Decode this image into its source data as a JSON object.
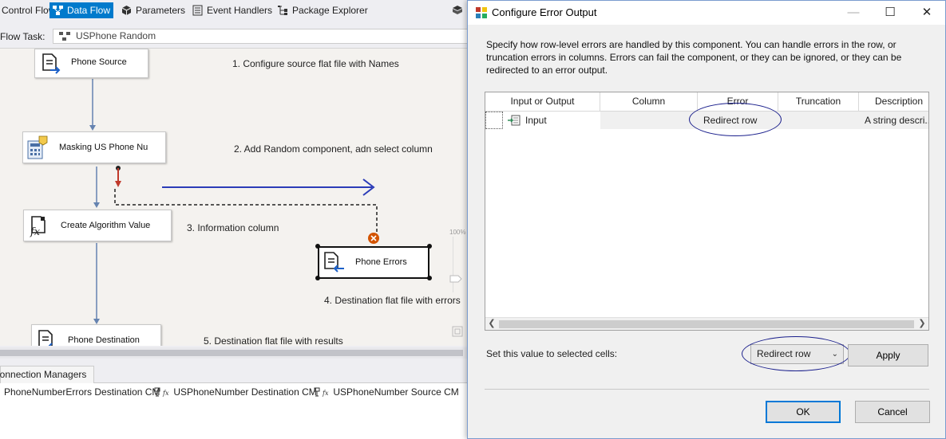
{
  "designer": {
    "tabs": [
      {
        "label": "Control Flow",
        "icon": "control-flow-icon"
      },
      {
        "label": "Data Flow",
        "icon": "data-flow-icon",
        "active": true
      },
      {
        "label": "Parameters",
        "icon": "parameters-icon"
      },
      {
        "label": "Event Handlers",
        "icon": "event-handlers-icon"
      },
      {
        "label": "Package Explorer",
        "icon": "package-explorer-icon"
      }
    ],
    "task_label": "Flow Task:",
    "task_value": "USPhone Random",
    "components": {
      "phone_source": "Phone Source",
      "masking": "Masking US Phone Nu",
      "create_algorithm": "Create Algorithm Value",
      "phone_errors": "Phone Errors",
      "phone_destination": "Phone Destination"
    },
    "notes": {
      "n1": "1. Configure source flat file with Names",
      "n2": "2. Add Random component, adn select column",
      "n3": "3. Information column",
      "n4": "4. Destination flat file with errors",
      "n5": "5. Destination flat file with results"
    },
    "zoom": "100%",
    "connection_managers_tab": "Connection Managers",
    "connection_managers": [
      "PhoneNumberErrors Destination CM",
      "USPhoneNumber Destination CM",
      "USPhoneNumber Source CM"
    ]
  },
  "dialog": {
    "title": "Configure Error Output",
    "description": "Specify how row-level errors are handled by this component. You can handle errors in the row, or truncation errors in columns. Errors can fail the component, or they can be ignored, or they can be redirected to an error output.",
    "columns": {
      "input_or_output": "Input or Output",
      "column": "Column",
      "error": "Error",
      "truncation": "Truncation",
      "description": "Description"
    },
    "rows": [
      {
        "input_or_output": "Input",
        "column": "",
        "error": "Redirect row",
        "truncation": "",
        "description": "A string descri..."
      }
    ],
    "set_value_label": "Set this value to selected cells:",
    "set_value_selected": "Redirect row",
    "apply_label": "Apply",
    "ok_label": "OK",
    "cancel_label": "Cancel"
  },
  "colors": {
    "accent": "#007acc",
    "annotation_ellipse": "#1a1f8c",
    "annotation_arrow": "#2b3cb8",
    "error_path": "#c0392b"
  }
}
